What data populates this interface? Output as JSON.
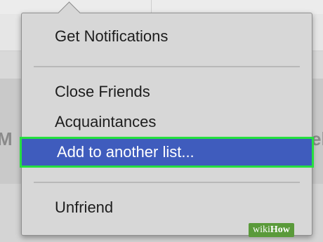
{
  "background": {
    "left_fragment": "M",
    "right_fragment": "el"
  },
  "menu": {
    "items": [
      {
        "label": "Get Notifications"
      },
      {
        "label": "Close Friends"
      },
      {
        "label": "Acquaintances"
      },
      {
        "label": "Add to another list...",
        "highlighted": true
      },
      {
        "label": "Unfriend"
      }
    ]
  },
  "watermark": {
    "text_prefix": "wiki",
    "text_suffix": "How"
  },
  "colors": {
    "highlight": "#3f5cbd",
    "highlight_outline": "#26e040",
    "menu_background": "#d7d7d7"
  }
}
